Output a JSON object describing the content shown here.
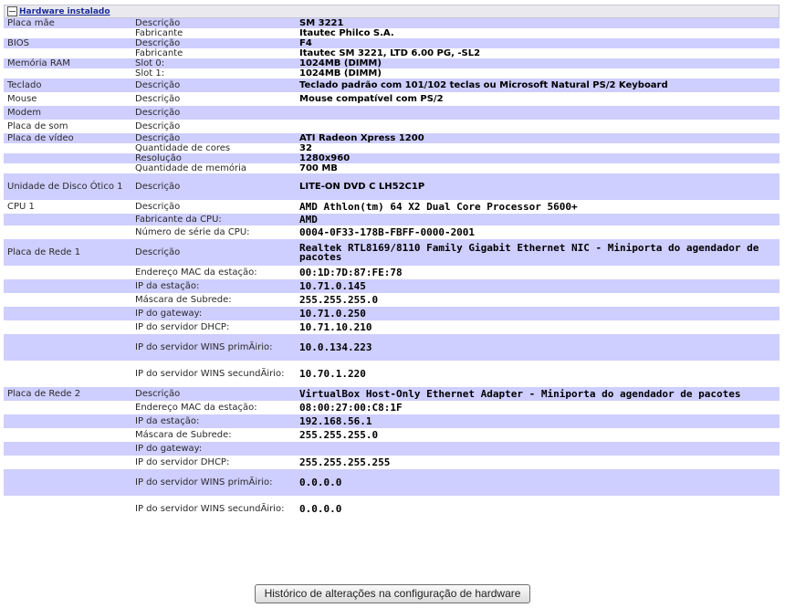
{
  "section": {
    "title": "Hardware instalado",
    "toggle_icon": "collapse-icon"
  },
  "rows": [
    {
      "c1": "Placa mãe",
      "c2": "Descrição",
      "v": "SM 3221",
      "shade": true,
      "h": 11,
      "mono": false
    },
    {
      "c1": "",
      "c2": "Fabricante",
      "v": "Itautec Philco S.A.",
      "shade": false,
      "h": 11,
      "mono": false
    },
    {
      "c1": "BIOS",
      "c2": "Descrição",
      "v": "F4",
      "shade": true,
      "h": 11,
      "mono": false
    },
    {
      "c1": "",
      "c2": "Fabricante",
      "v": "Itautec SM 3221, LTD 6.00 PG, -SL2",
      "shade": false,
      "h": 11,
      "mono": false
    },
    {
      "c1": "Memória RAM",
      "c2": "Slot 0:",
      "v": "1024MB (DIMM)",
      "shade": true,
      "h": 11,
      "mono": false
    },
    {
      "c1": "",
      "c2": "Slot 1:",
      "v": "1024MB (DIMM)",
      "shade": false,
      "h": 11,
      "mono": false
    },
    {
      "c1": "Teclado",
      "c2": "Descrição",
      "v": "Teclado padrão com 101/102 teclas ou Microsoft Natural PS/2 Keyboard",
      "shade": true,
      "h": 15,
      "mono": false
    },
    {
      "c1": "Mouse",
      "c2": "Descrição",
      "v": "Mouse compatível com PS/2",
      "shade": false,
      "h": 15,
      "mono": false
    },
    {
      "c1": "Modem",
      "c2": "Descrição",
      "v": "",
      "shade": true,
      "h": 15,
      "mono": false
    },
    {
      "c1": "Placa de som",
      "c2": "Descrição",
      "v": "",
      "shade": false,
      "h": 15,
      "mono": false
    },
    {
      "c1": "Placa de vídeo",
      "c2": "Descrição",
      "v": "ATI Radeon Xpress 1200",
      "shade": true,
      "h": 11,
      "mono": false
    },
    {
      "c1": "",
      "c2": "Quantidade de cores",
      "v": "32",
      "shade": false,
      "h": 11,
      "mono": false
    },
    {
      "c1": "",
      "c2": "Resolução",
      "v": "1280x960",
      "shade": true,
      "h": 11,
      "mono": false
    },
    {
      "c1": "",
      "c2": "Quantidade de memória",
      "v": "700 MB",
      "shade": false,
      "h": 11,
      "mono": false
    },
    {
      "c1": "Unidade de Disco Ótico 1",
      "c2": "Descrição",
      "v": "LITE-ON DVD C LH52C1P",
      "shade": true,
      "h": 29,
      "mono": false
    },
    {
      "c1": "CPU 1",
      "c2": "Descrição",
      "v": "AMD Athlon(tm) 64 X2 Dual Core Processor 5600+",
      "shade": false,
      "h": 15,
      "mono": true
    },
    {
      "c1": "",
      "c2": "Fabricante da CPU:",
      "v": "AMD",
      "shade": true,
      "h": 11,
      "mono": true
    },
    {
      "c1": "",
      "c2": "Número de série da CPU:",
      "v": "0004-0F33-178B-FBFF-0000-2001",
      "shade": false,
      "h": 15,
      "mono": true
    },
    {
      "c1": "Placa de Rede 1",
      "c2": "Descrição",
      "v": "Realtek RTL8169/8110 Family Gigabit Ethernet NIC - Miniporta do agendador de pacotes",
      "shade": true,
      "h": 29,
      "mono": true,
      "wrap": true
    },
    {
      "c1": "",
      "c2": "Endereço MAC da estação:",
      "v": "00:1D:7D:87:FE:78",
      "shade": false,
      "h": 15,
      "mono": true
    },
    {
      "c1": "",
      "c2": "IP da estação:",
      "v": "10.71.0.145",
      "shade": true,
      "h": 15,
      "mono": true
    },
    {
      "c1": "",
      "c2": "Máscara de Subrede:",
      "v": "255.255.255.0",
      "shade": false,
      "h": 15,
      "mono": true
    },
    {
      "c1": "",
      "c2": "IP do gateway:",
      "v": "10.71.0.250",
      "shade": true,
      "h": 15,
      "mono": true
    },
    {
      "c1": "",
      "c2": "IP do servidor DHCP:",
      "v": "10.71.10.210",
      "shade": false,
      "h": 15,
      "mono": true
    },
    {
      "c1": "",
      "c2": "IP do servidor WINS primÃirio:",
      "v": "10.0.134.223",
      "shade": true,
      "h": 29,
      "mono": true,
      "wrap2": true
    },
    {
      "c1": "",
      "c2": "IP do servidor WINS secundÃirio:",
      "v": "10.70.1.220",
      "shade": false,
      "h": 29,
      "mono": true,
      "wrap2": true
    },
    {
      "c1": "Placa de Rede 2",
      "c2": "Descrição",
      "v": "VirtualBox Host-Only Ethernet Adapter - Miniporta do agendador de pacotes",
      "shade": true,
      "h": 15,
      "mono": true
    },
    {
      "c1": "",
      "c2": "Endereço MAC da estação:",
      "v": "08:00:27:00:C8:1F",
      "shade": false,
      "h": 15,
      "mono": true
    },
    {
      "c1": "",
      "c2": "IP da estação:",
      "v": "192.168.56.1",
      "shade": true,
      "h": 15,
      "mono": true
    },
    {
      "c1": "",
      "c2": "Máscara de Subrede:",
      "v": "255.255.255.0",
      "shade": false,
      "h": 15,
      "mono": true
    },
    {
      "c1": "",
      "c2": "IP do gateway:",
      "v": "",
      "shade": true,
      "h": 15,
      "mono": true
    },
    {
      "c1": "",
      "c2": "IP do servidor DHCP:",
      "v": "255.255.255.255",
      "shade": false,
      "h": 15,
      "mono": true
    },
    {
      "c1": "",
      "c2": "IP do servidor WINS primÃirio:",
      "v": "0.0.0.0",
      "shade": true,
      "h": 29,
      "mono": true,
      "wrap2": true
    },
    {
      "c1": "",
      "c2": "IP do servidor WINS secundÃirio:",
      "v": "0.0.0.0",
      "shade": false,
      "h": 29,
      "mono": true,
      "wrap2": true
    }
  ],
  "button": {
    "label": "Histórico de alterações na configuração de hardware"
  }
}
